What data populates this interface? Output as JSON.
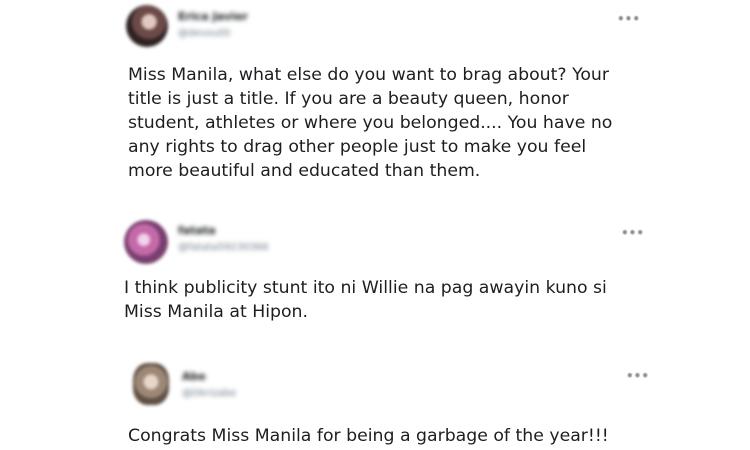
{
  "tweets": [
    {
      "display_name": "Erica Javier",
      "handle": "@devouttt",
      "more_icon": "ellipsis-icon",
      "text": "Miss Manila, what else do you want to brag about? Your\ntitle is just a title. If you are a beauty queen, honor\nstudent, athletes or where you belonged.... You have no\nany rights to drag other people just to make you feel\nmore beautiful and educated than them.",
      "avatar_color": "#5a3a3a"
    },
    {
      "display_name": "fatata",
      "handle": "@fatata59230366",
      "more_icon": "ellipsis-icon",
      "text": "I think publicity stunt ito ni Willie na pag awayin kuno si\nMiss Manila at Hipon.",
      "avatar_color": "#c06fa6"
    },
    {
      "display_name": "Abe",
      "handle": "@Dkrizabe",
      "more_icon": "ellipsis-icon",
      "text": "Congrats Miss Manila for being a garbage of the year!!!",
      "avatar_color": "#8d7a6b"
    }
  ]
}
